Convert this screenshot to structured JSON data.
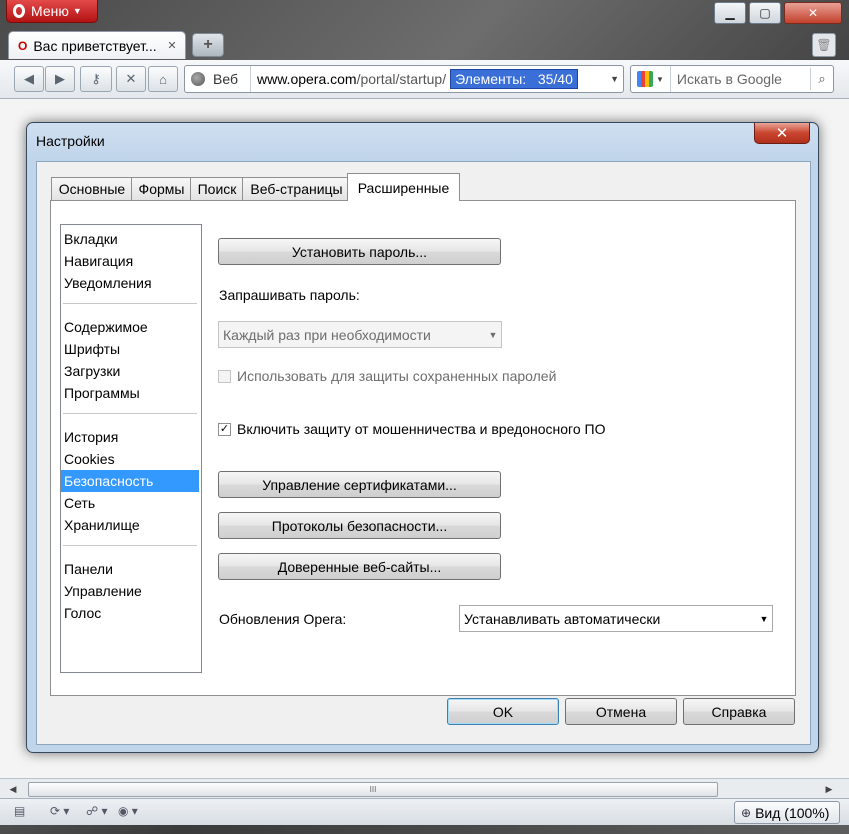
{
  "browser": {
    "menu_label": "Меню",
    "tab_title": "Вас приветствует...",
    "address": {
      "mode_label": "Веб",
      "url_host": "www.opera.com",
      "url_path": "/portal/startup/",
      "find_label": "Элементы:",
      "find_count": "35/40"
    },
    "search_placeholder": "Искать в Google",
    "zoom_label": "Вид (100%)",
    "scroll_grip": "III"
  },
  "dialog": {
    "title": "Настройки",
    "tabs": [
      {
        "label": "Основные"
      },
      {
        "label": "Формы"
      },
      {
        "label": "Поиск"
      },
      {
        "label": "Веб-страницы"
      },
      {
        "label": "Расширенные"
      }
    ],
    "categories": {
      "group1": [
        "Вкладки",
        "Навигация",
        "Уведомления"
      ],
      "group2": [
        "Содержимое",
        "Шрифты",
        "Загрузки",
        "Программы"
      ],
      "group3": [
        "История",
        "Cookies",
        "Безопасность",
        "Сеть",
        "Хранилище"
      ],
      "group4": [
        "Панели",
        "Управление",
        "Голос"
      ]
    },
    "security": {
      "set_password_button": "Установить пароль...",
      "ask_password_label": "Запрашивать пароль:",
      "ask_password_value": "Каждый раз при необходимости",
      "use_for_saved_label": "Использовать для защиты сохраненных паролей",
      "fraud_protection_label": "Включить защиту от мошенничества и вредоносного ПО",
      "fraud_protection_checked": true,
      "manage_certs_button": "Управление сертификатами...",
      "security_protocols_button": "Протоколы безопасности...",
      "trusted_sites_button": "Доверенные веб-сайты...",
      "updates_label": "Обновления Opera:",
      "updates_value": "Устанавливать автоматически"
    },
    "footer": {
      "ok": "OK",
      "cancel": "Отмена",
      "help": "Справка"
    }
  }
}
